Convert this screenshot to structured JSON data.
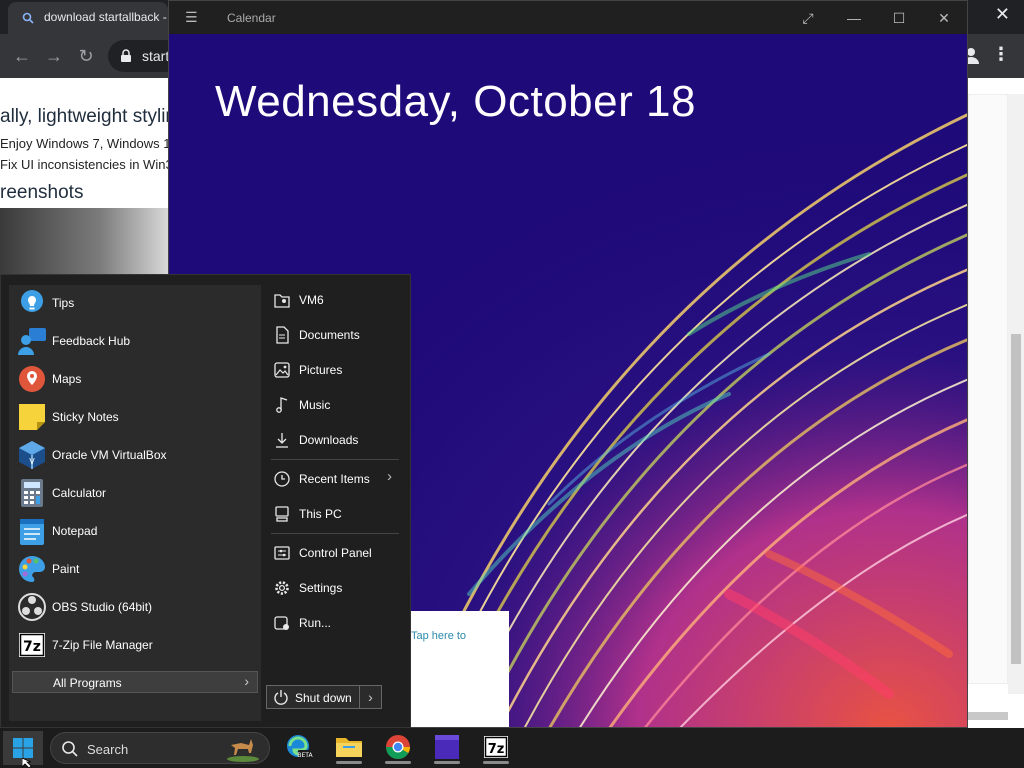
{
  "browser": {
    "tab_title": "download startallback -",
    "address": "start",
    "page": {
      "heading": "ally, lightweight stylin",
      "bullets": [
        "Enjoy Windows 7, Windows 1",
        "Fix UI inconsistencies in Win3"
      ],
      "section": "reenshots"
    }
  },
  "calendar": {
    "title": "Calendar",
    "date_heading": "Wednesday, October 18",
    "notice": "Tap here to"
  },
  "start_menu": {
    "apps": [
      {
        "label": "Tips",
        "icon": "tips-icon"
      },
      {
        "label": "Feedback Hub",
        "icon": "feedback-hub-icon"
      },
      {
        "label": "Maps",
        "icon": "maps-icon"
      },
      {
        "label": "Sticky Notes",
        "icon": "sticky-notes-icon"
      },
      {
        "label": "Oracle VM VirtualBox",
        "icon": "virtualbox-icon"
      },
      {
        "label": "Calculator",
        "icon": "calculator-icon"
      },
      {
        "label": "Notepad",
        "icon": "notepad-icon"
      },
      {
        "label": "Paint",
        "icon": "paint-icon"
      },
      {
        "label": "OBS Studio (64bit)",
        "icon": "obs-icon"
      },
      {
        "label": "7-Zip File Manager",
        "icon": "7zip-icon"
      }
    ],
    "all_programs": "All Programs",
    "places": [
      {
        "label": "VM6",
        "icon": "user-folder-icon"
      },
      {
        "label": "Documents",
        "icon": "document-icon"
      },
      {
        "label": "Pictures",
        "icon": "pictures-icon"
      },
      {
        "label": "Music",
        "icon": "music-icon"
      },
      {
        "label": "Downloads",
        "icon": "download-icon"
      },
      {
        "label": "Recent Items",
        "icon": "clock-icon"
      },
      {
        "label": "This PC",
        "icon": "computer-icon"
      },
      {
        "label": "Control Panel",
        "icon": "control-panel-icon"
      },
      {
        "label": "Settings",
        "icon": "gear-icon"
      },
      {
        "label": "Run...",
        "icon": "run-icon"
      }
    ],
    "shutdown": "Shut down"
  },
  "taskbar": {
    "search_label": "Search",
    "pinned": [
      "edge-beta-icon",
      "file-explorer-icon",
      "chrome-icon",
      "calendar-app-icon",
      "7zip-icon"
    ]
  },
  "colors": {
    "calendar_bg": "#1f0a7a",
    "start_menu_bg": "#1f1f1f",
    "taskbar_bg": "#1c1c1c",
    "windows_blue": "#29a3e6"
  }
}
